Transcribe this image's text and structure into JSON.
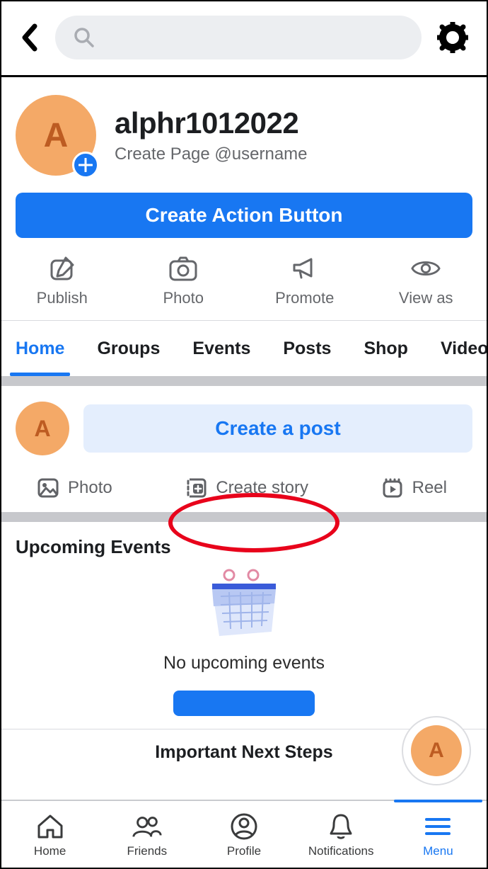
{
  "topbar": {
    "search_placeholder": ""
  },
  "profile": {
    "avatar_letter": "A",
    "name": "alphr1012022",
    "subtitle": "Create Page @username"
  },
  "action_button": {
    "label": "Create Action Button"
  },
  "quick_actions": [
    {
      "label": "Publish"
    },
    {
      "label": "Photo"
    },
    {
      "label": "Promote"
    },
    {
      "label": "View as"
    }
  ],
  "tabs": [
    "Home",
    "Groups",
    "Events",
    "Posts",
    "Shop",
    "Videos"
  ],
  "active_tab_index": 0,
  "create_post": {
    "avatar_letter": "A",
    "button_label": "Create a post",
    "actions": [
      {
        "label": "Photo"
      },
      {
        "label": "Create story"
      },
      {
        "label": "Reel"
      }
    ]
  },
  "events": {
    "title": "Upcoming Events",
    "empty_text": "No upcoming events"
  },
  "next_steps": {
    "title": "Important Next Steps",
    "active_dot": 0,
    "dot_count": 4
  },
  "float_avatar_letter": "A",
  "bottom_nav": [
    {
      "label": "Home"
    },
    {
      "label": "Friends"
    },
    {
      "label": "Profile"
    },
    {
      "label": "Notifications"
    },
    {
      "label": "Menu"
    }
  ],
  "active_nav_index": 4
}
